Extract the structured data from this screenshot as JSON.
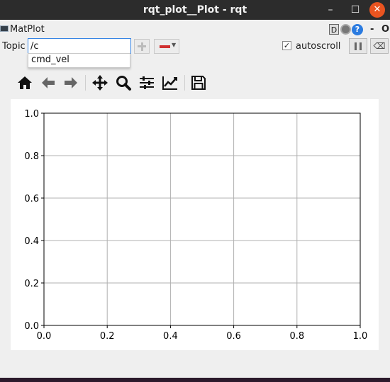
{
  "window": {
    "title": "rqt_plot__Plot - rqt",
    "minimize": "–",
    "maximize": "☐",
    "close": "✕"
  },
  "plugin": {
    "name": "MatPlot",
    "d_button": "D",
    "help_button": "?",
    "dash": "-",
    "o": "O"
  },
  "topic": {
    "label": "Topic",
    "value": "/c",
    "autocomplete": [
      "cmd_vel"
    ],
    "autoscroll_label": "autoscroll",
    "autoscroll_checked": true,
    "checkmark": "✓",
    "clear_glyph": "⌫"
  },
  "toolbar": {
    "icons": [
      "home-icon",
      "back-arrow-icon",
      "forward-arrow-icon",
      "pan-icon",
      "zoom-icon",
      "subplots-config-icon",
      "edit-axis-icon",
      "save-icon"
    ]
  },
  "chart_data": {
    "type": "line",
    "series": [],
    "xlim": [
      0.0,
      1.0
    ],
    "ylim": [
      0.0,
      1.0
    ],
    "x_ticks": [
      "0.0",
      "0.2",
      "0.4",
      "0.6",
      "0.8",
      "1.0"
    ],
    "y_ticks": [
      "0.0",
      "0.2",
      "0.4",
      "0.6",
      "0.8",
      "1.0"
    ],
    "grid": true
  }
}
